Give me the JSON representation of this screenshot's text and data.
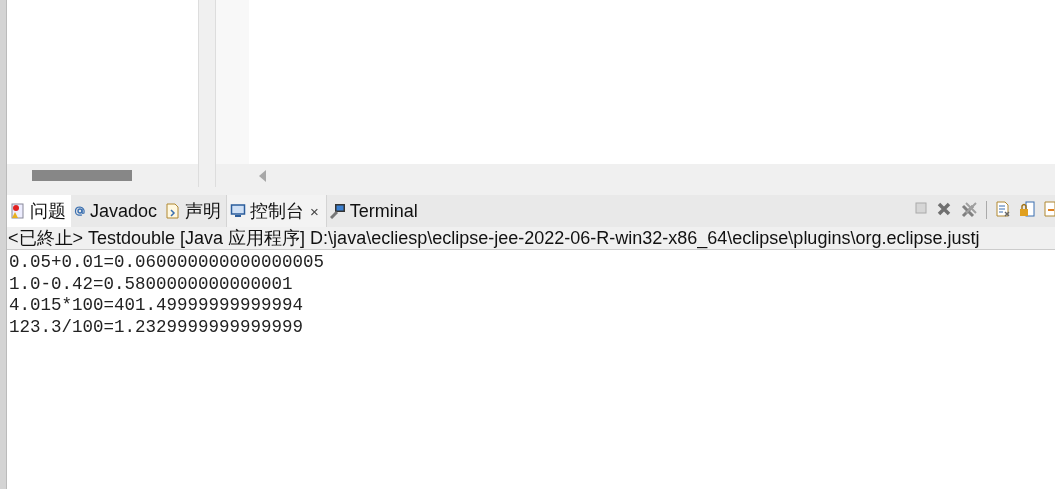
{
  "tabs": [
    {
      "label": "问题",
      "selected": false
    },
    {
      "label": "Javadoc",
      "selected": false
    },
    {
      "label": "声明",
      "selected": false
    },
    {
      "label": "控制台",
      "selected": true,
      "close": "×"
    },
    {
      "label": "Terminal",
      "selected": false
    }
  ],
  "console": {
    "header": "<已終止> Testdouble [Java 应用程序] D:\\java\\ecliesp\\eclipse-jee-2022-06-R-win32-x86_64\\eclipse\\plugins\\org.eclipse.justj",
    "lines": [
      "0.05+0.01=0.060000000000000005",
      "1.0-0.42=0.5800000000000001",
      "4.015*100=401.49999999999994",
      "123.3/100=1.2329999999999999"
    ]
  }
}
